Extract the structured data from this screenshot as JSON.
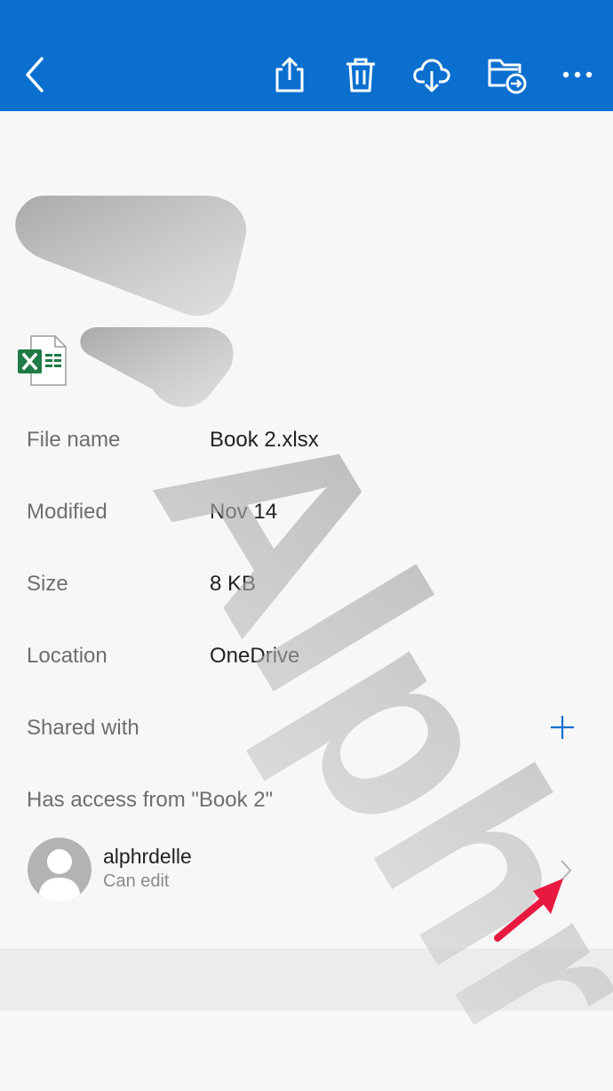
{
  "toolbar": {
    "back_icon": "chevron-left-icon",
    "share_icon": "share-icon",
    "delete_icon": "trash-icon",
    "download_icon": "cloud-download-icon",
    "move_icon": "move-to-folder-icon",
    "more_icon": "more-icon"
  },
  "file": {
    "icon": "excel-file-icon"
  },
  "details": [
    {
      "label": "File name",
      "value": "Book 2.xlsx"
    },
    {
      "label": "Modified",
      "value": "Nov 14"
    },
    {
      "label": "Size",
      "value": "8 KB"
    },
    {
      "label": "Location",
      "value": "OneDrive"
    }
  ],
  "shared": {
    "label": "Shared with",
    "add_icon": "plus-icon"
  },
  "access": {
    "title": "Has access from \"Book 2\"",
    "user": {
      "name": "alphrdelle",
      "permission": "Can edit"
    }
  },
  "watermark": {
    "text": "Alphr"
  },
  "colors": {
    "accent": "#0a6fcf",
    "background": "#f7f7f7",
    "excel_green": "#1f7a45",
    "annotation_arrow": "#e8193f"
  }
}
